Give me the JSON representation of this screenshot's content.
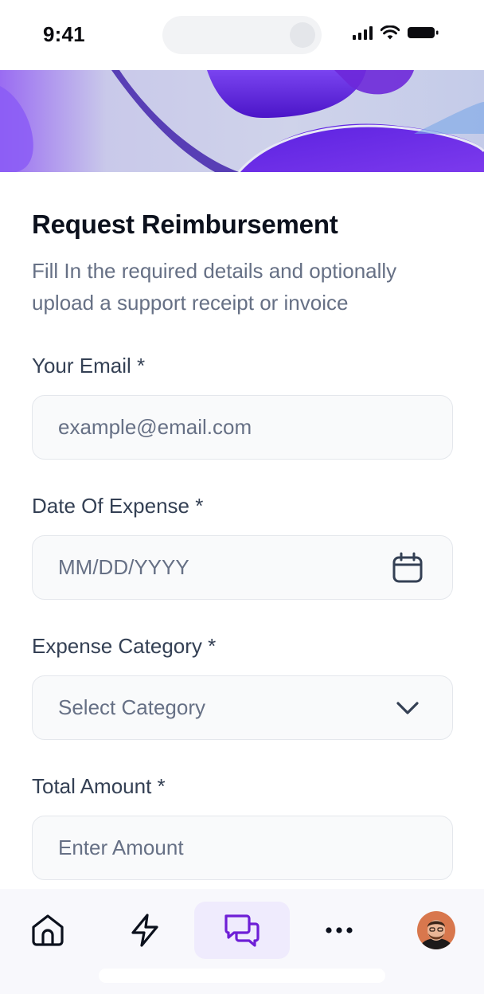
{
  "status_bar": {
    "time": "9:41"
  },
  "form": {
    "title": "Request Reimbursement",
    "subtitle": "Fill In the required details and optionally upload a support receipt or invoice",
    "fields": [
      {
        "label": "Your Email *",
        "placeholder": "example@email.com",
        "icon": "none"
      },
      {
        "label": "Date Of Expense *",
        "placeholder": "MM/DD/YYYY",
        "icon": "calendar-icon"
      },
      {
        "label": "Expense Category *",
        "placeholder": "Select Category",
        "icon": "chevron-down-icon"
      },
      {
        "label": "Total Amount *",
        "placeholder": "Enter Amount",
        "icon": "none"
      }
    ]
  },
  "bottom_nav": {
    "items": [
      {
        "icon": "home-icon",
        "active": false
      },
      {
        "icon": "lightning-icon",
        "active": false
      },
      {
        "icon": "chat-icon",
        "active": true
      },
      {
        "icon": "more-icon",
        "active": false
      },
      {
        "icon": "avatar",
        "active": false
      }
    ]
  },
  "colors": {
    "accent": "#6E1FD6",
    "active_nav_bg": "#EFEBFD",
    "field_bg": "#F9FAFB",
    "field_border": "#E4E7EC",
    "placeholder": "#667085"
  }
}
